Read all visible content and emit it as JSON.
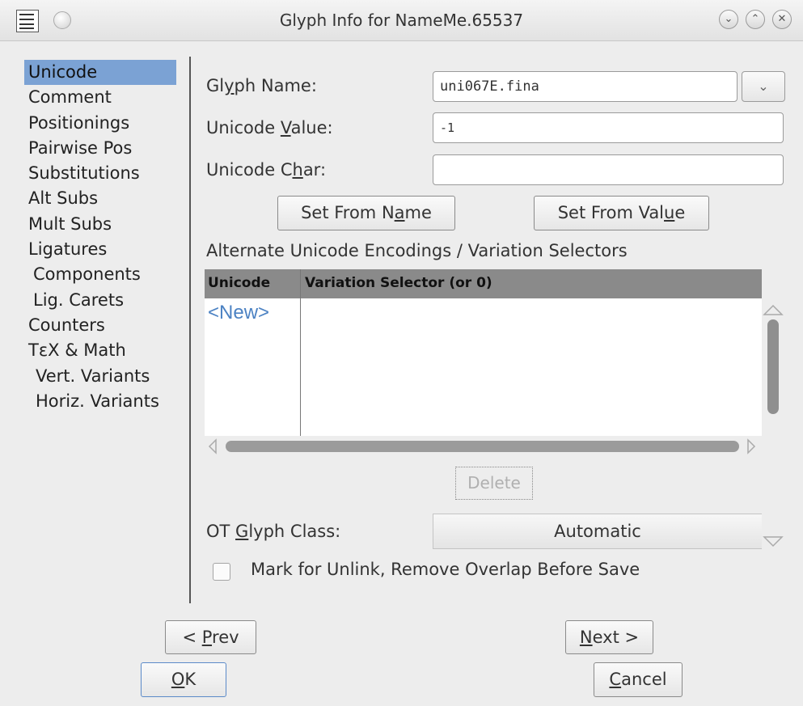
{
  "window": {
    "title": "Glyph Info for NameMe.65537"
  },
  "sidebar": {
    "items": [
      {
        "label": "Unicode"
      },
      {
        "label": "Comment"
      },
      {
        "label": "Positionings"
      },
      {
        "label": "Pairwise Pos"
      },
      {
        "label": "Substitutions"
      },
      {
        "label": "Alt Subs"
      },
      {
        "label": "Mult Subs"
      },
      {
        "label": "Ligatures"
      },
      {
        "label": "Components"
      },
      {
        "label": "Lig. Carets"
      },
      {
        "label": "Counters"
      },
      {
        "label": "TεX & Math"
      },
      {
        "label": "Vert. Variants"
      },
      {
        "label": "Horiz. Variants"
      }
    ]
  },
  "form": {
    "glyph_name": {
      "pre": "Gl",
      "key": "y",
      "post": "ph Name:",
      "value": "uni067E.fina"
    },
    "unicode_value": {
      "pre": "Unicode ",
      "key": "V",
      "post": "alue:",
      "value": "-1"
    },
    "unicode_char": {
      "pre": "Unicode C",
      "key": "h",
      "post": "ar:",
      "value": ""
    },
    "set_from_name": {
      "pre": "Set From N",
      "key": "a",
      "post": "me"
    },
    "set_from_value": {
      "pre": "Set From Val",
      "key": "u",
      "post": "e"
    },
    "alt_encodings_label": "Alternate Unicode Encodings / Variation Selectors"
  },
  "alt_table": {
    "columns": [
      "Unicode",
      "Variation Selector (or 0)"
    ],
    "new_row": "<New>"
  },
  "delete_button": "Delete",
  "ot_glyph_class": {
    "pre": "OT ",
    "key": "G",
    "post": "lyph Class:",
    "value": "Automatic"
  },
  "mark_unlink": {
    "label": "Mark for Unlink, Remove Overlap Before Save",
    "checked": false
  },
  "buttons": {
    "prev": {
      "pre": "< ",
      "key": "P",
      "post": "rev"
    },
    "next": {
      "pre": "",
      "key": "N",
      "post": "ext >"
    },
    "ok": {
      "pre": "",
      "key": "O",
      "post": "K"
    },
    "cancel": {
      "pre": "",
      "key": "C",
      "post": "ancel"
    }
  }
}
